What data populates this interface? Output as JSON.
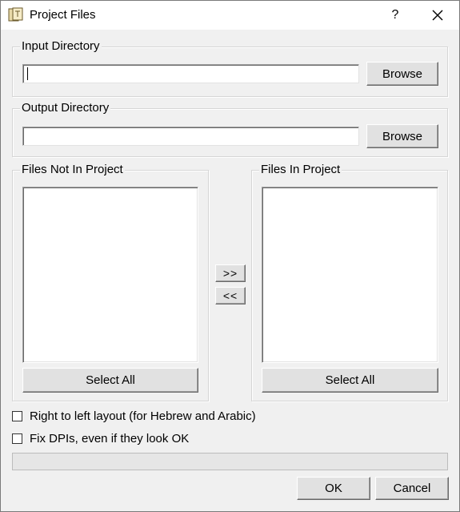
{
  "window": {
    "title": "Project Files",
    "help_label": "?"
  },
  "input_dir": {
    "legend": "Input Directory",
    "value": "",
    "browse_label": "Browse"
  },
  "output_dir": {
    "legend": "Output Directory",
    "value": "",
    "browse_label": "Browse"
  },
  "files_not_in_project": {
    "legend": "Files Not In Project",
    "items": [],
    "select_all_label": "Select All"
  },
  "files_in_project": {
    "legend": "Files In Project",
    "items": [],
    "select_all_label": "Select All"
  },
  "transfer": {
    "add_label": ">>",
    "remove_label": "<<"
  },
  "options": {
    "rtl_label": "Right to left layout (for Hebrew and Arabic)",
    "rtl_checked": false,
    "fix_dpi_label": "Fix DPIs, even if they look OK",
    "fix_dpi_checked": false
  },
  "progress": {
    "value": 0
  },
  "footer": {
    "ok_label": "OK",
    "cancel_label": "Cancel"
  }
}
